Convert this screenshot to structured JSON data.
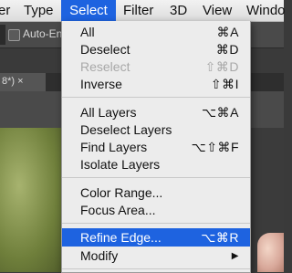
{
  "menubar": {
    "items": [
      {
        "label": "er"
      },
      {
        "label": "Type"
      },
      {
        "label": "Select"
      },
      {
        "label": "Filter"
      },
      {
        "label": "3D"
      },
      {
        "label": "View"
      },
      {
        "label": "Windo"
      }
    ]
  },
  "options_bar": {
    "auto_enhance_label": "Auto-Enh"
  },
  "doc_tab": {
    "label": "8*) ×"
  },
  "select_menu": {
    "items": [
      {
        "label": "All",
        "shortcut": "⌘A"
      },
      {
        "label": "Deselect",
        "shortcut": "⌘D"
      },
      {
        "label": "Reselect",
        "shortcut": "⇧⌘D",
        "disabled": true
      },
      {
        "label": "Inverse",
        "shortcut": "⇧⌘I"
      },
      {
        "label": "All Layers",
        "shortcut": "⌥⌘A"
      },
      {
        "label": "Deselect Layers",
        "shortcut": ""
      },
      {
        "label": "Find Layers",
        "shortcut": "⌥⇧⌘F"
      },
      {
        "label": "Isolate Layers",
        "shortcut": ""
      },
      {
        "label": "Color Range...",
        "shortcut": ""
      },
      {
        "label": "Focus Area...",
        "shortcut": ""
      },
      {
        "label": "Refine Edge...",
        "shortcut": "⌥⌘R",
        "highlighted": true
      },
      {
        "label": "Modify",
        "shortcut": "▶"
      }
    ]
  },
  "colors": {
    "highlight": "#1e63e0",
    "menu_bg": "#ececec",
    "disabled_text": "#a8a8a8"
  }
}
